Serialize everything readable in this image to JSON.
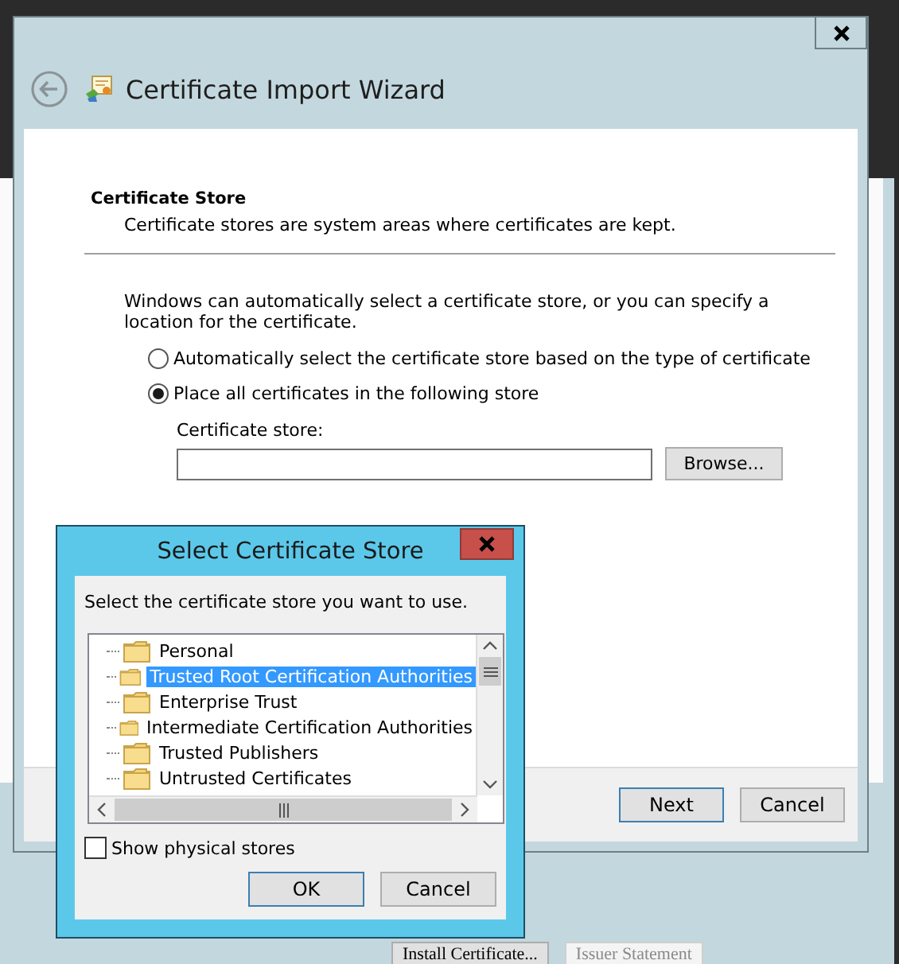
{
  "background_window": {
    "buttons": [
      {
        "label": "Install Certificate...",
        "disabled": false
      },
      {
        "label": "Issuer Statement",
        "disabled": true
      }
    ]
  },
  "wizard": {
    "title": "Certificate Import Wizard",
    "section_title": "Certificate Store",
    "section_description": "Certificate stores are system areas where certificates are kept.",
    "intro": "Windows can automatically select a certificate store, or you can specify a location for the certificate.",
    "options": [
      {
        "label": "Automatically select the certificate store based on the type of certificate",
        "selected": false
      },
      {
        "label": "Place all certificates in the following store",
        "selected": true
      }
    ],
    "store_label": "Certificate store:",
    "browse_button": "Browse...",
    "buttons": [
      {
        "label": "Next",
        "default": true
      },
      {
        "label": "Cancel",
        "default": false
      }
    ]
  },
  "dialog": {
    "title": "Select Certificate Store",
    "prompt": "Select the certificate store you want to use.",
    "stores": [
      {
        "label": "Personal",
        "selected": false
      },
      {
        "label": "Trusted Root Certification Authorities",
        "selected": true
      },
      {
        "label": "Enterprise Trust",
        "selected": false
      },
      {
        "label": "Intermediate Certification Authorities",
        "selected": false
      },
      {
        "label": "Trusted Publishers",
        "selected": false
      },
      {
        "label": "Untrusted Certificates",
        "selected": false
      }
    ],
    "show_physical": {
      "label": "Show physical stores",
      "checked": false
    },
    "buttons": [
      {
        "label": "OK",
        "default": true
      },
      {
        "label": "Cancel",
        "default": false
      }
    ]
  }
}
